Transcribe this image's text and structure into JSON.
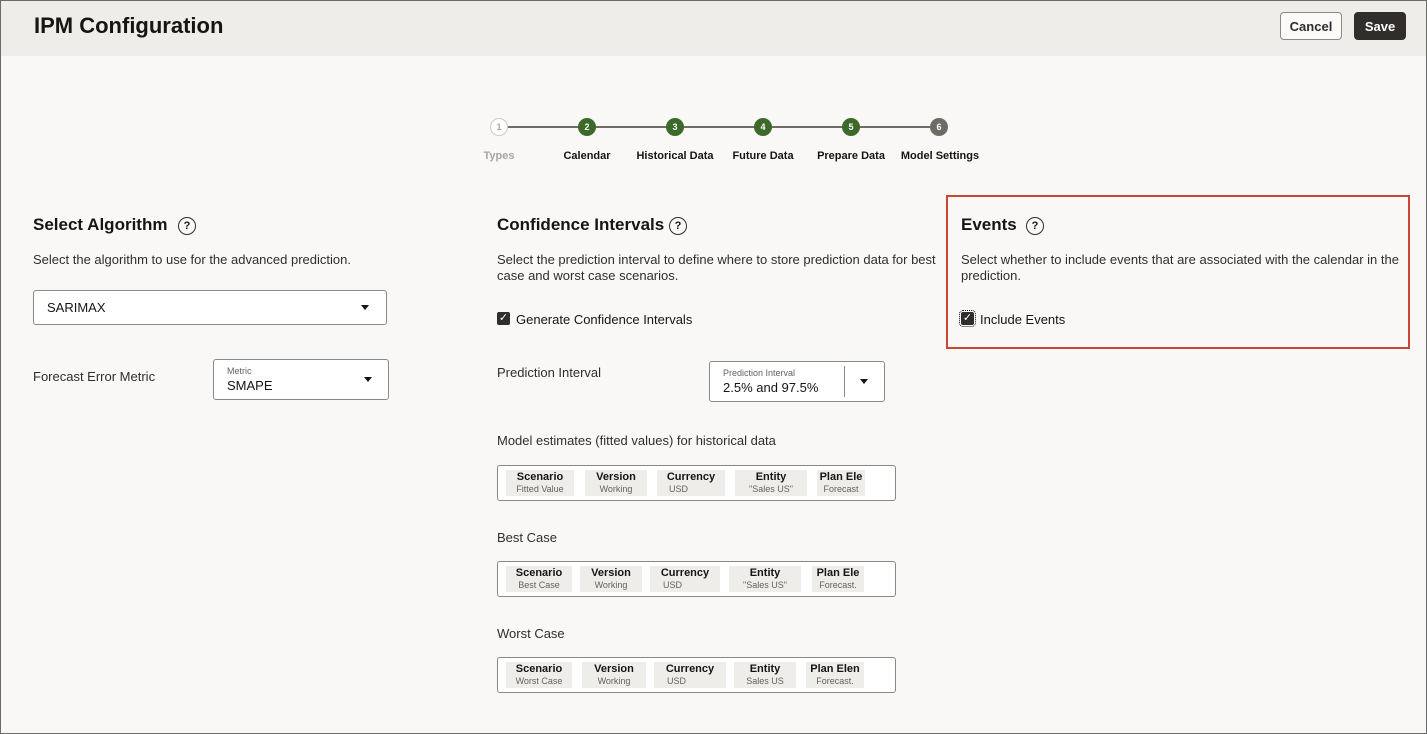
{
  "header": {
    "title": "IPM Configuration",
    "cancel_label": "Cancel",
    "save_label": "Save"
  },
  "stepper": {
    "steps": [
      {
        "number": "1",
        "label": "Types",
        "state": "visited"
      },
      {
        "number": "2",
        "label": "Calendar",
        "state": "complete"
      },
      {
        "number": "3",
        "label": "Historical Data",
        "state": "complete"
      },
      {
        "number": "4",
        "label": "Future Data",
        "state": "complete"
      },
      {
        "number": "5",
        "label": "Prepare Data",
        "state": "complete"
      },
      {
        "number": "6",
        "label": "Model Settings",
        "state": "current"
      }
    ]
  },
  "algorithm": {
    "title": "Select Algorithm",
    "description": "Select the algorithm to use for the advanced prediction.",
    "selected": "SARIMAX",
    "error_metric_label": "Forecast Error Metric",
    "metric_field_label": "Metric",
    "metric_value": "SMAPE"
  },
  "confidence": {
    "title": "Confidence Intervals",
    "description_line1": "Select the prediction interval to define where to store prediction data for best",
    "description_line2": "case and worst case scenarios.",
    "generate_label": "Generate Confidence Intervals",
    "generate_checked": true,
    "prediction_interval_label": "Prediction Interval",
    "prediction_interval_field_label": "Prediction Interval",
    "prediction_interval_value": "2.5% and 97.5%",
    "fitted_label": "Model estimates (fitted values) for historical data",
    "best_label": "Best Case",
    "worst_label": "Worst Case",
    "fitted_pov": [
      {
        "dimension": "Scenario",
        "member": "Fitted Value"
      },
      {
        "dimension": "Version",
        "member": "Working"
      },
      {
        "dimension": "Currency",
        "member": "USD"
      },
      {
        "dimension": "Entity",
        "member": "\"Sales US\""
      },
      {
        "dimension": "Plan Ele",
        "member": "Forecast"
      }
    ],
    "best_pov": [
      {
        "dimension": "Scenario",
        "member": "Best Case"
      },
      {
        "dimension": "Version",
        "member": "Working"
      },
      {
        "dimension": "Currency",
        "member": "USD"
      },
      {
        "dimension": "Entity",
        "member": "\"Sales US\""
      },
      {
        "dimension": "Plan Ele",
        "member": "Forecast."
      }
    ],
    "worst_pov": [
      {
        "dimension": "Scenario",
        "member": "Worst Case"
      },
      {
        "dimension": "Version",
        "member": "Working"
      },
      {
        "dimension": "Currency",
        "member": "USD"
      },
      {
        "dimension": "Entity",
        "member": "Sales US"
      },
      {
        "dimension": "Plan Elen",
        "member": "Forecast."
      }
    ]
  },
  "events": {
    "title": "Events",
    "description_line1": "Select whether to include events that are associated with the calendar in the",
    "description_line2": "prediction.",
    "include_label": "Include Events",
    "include_checked": true
  },
  "colors": {
    "step_complete": "#3d6a2b",
    "highlight": "#c74634",
    "save_button": "#312d2a"
  }
}
